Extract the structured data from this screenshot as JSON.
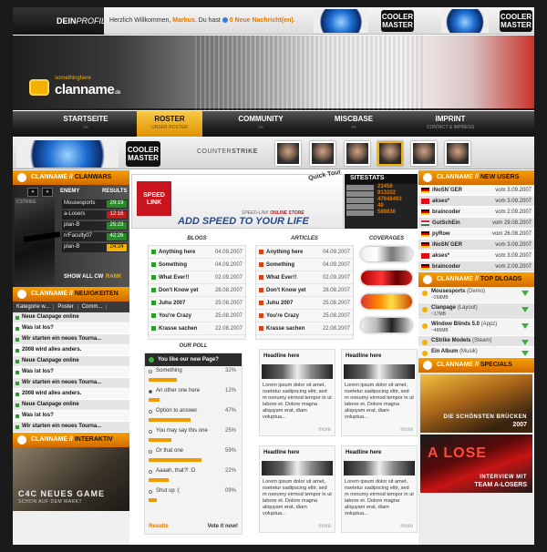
{
  "topbar": {
    "profile_prefix": "DEIN",
    "profile_suffix": "PROFIL",
    "welcome_text": "Herzlich Willkommen,",
    "user": "Markus",
    "you_have": ". Du hast",
    "messages": "0 Neue Nachricht(en)."
  },
  "brand": {
    "tagline": "somethinghere",
    "name": "clanname",
    "tld": ".de",
    "sponsor_a": "COOLER",
    "sponsor_b": "MASTER"
  },
  "nav": [
    {
      "label": "STARTSEITE",
      "sub": "»»"
    },
    {
      "label": "ROSTER",
      "sub": "UNSER ROSTER"
    },
    {
      "label": "COMMUNITY",
      "sub": "»»"
    },
    {
      "label": "MISCBASE",
      "sub": "»»"
    },
    {
      "label": "IMPRINT",
      "sub": "CONTACT & IMPRESS"
    }
  ],
  "strip": {
    "game_a": "COUNTER",
    "game_b": "STRIKE"
  },
  "clanwars": {
    "head_a": "CLANNAME",
    "head_b": "CLANWARS",
    "col_enemy": "ENEMY",
    "col_results": "RESULTS",
    "game": "CSTRIKE",
    "rows": [
      {
        "enemy": "Mousesports",
        "result": "29:19",
        "status": "win"
      },
      {
        "enemy": "a-Losers",
        "result": "12:16",
        "status": "loss"
      },
      {
        "enemy": "plan-B",
        "result": "25:23",
        "status": "win"
      },
      {
        "enemy": "n!Faculty07",
        "result": "42:26",
        "status": "win"
      },
      {
        "enemy": "plan-B",
        "result": "24:24",
        "status": "draw"
      }
    ],
    "tabs": "SHOW  ALL  CW",
    "rank": "RANK"
  },
  "news": {
    "head_a": "CLANNAME",
    "head_b": "NEUIGKEITEN",
    "filters": [
      "Kategorie w...",
      "Poster",
      "Comm..."
    ],
    "items": [
      "Neue Clanpage online",
      "Was ist los?",
      "Wir starten ein neues Tourna...",
      "2008 wird alles anders.",
      "Neue Clanpage online",
      "Was ist los?",
      "Wir starten ein neues Tourna...",
      "2008 wird alles anders.",
      "Neue Clanpage online",
      "Was ist los?",
      "Wir starten ein neues Tourna..."
    ]
  },
  "interaktiv": {
    "head_a": "CLANNAME",
    "head_b": "INTERAKTIV",
    "title": "C4C NEUES GAME",
    "sub": "SCHON AUF DEM MARKT"
  },
  "speedlink": {
    "logo": "SPEED LINK",
    "quick": "Quick Tour",
    "store_a": "SPEED-LINK",
    "store_b": "ONLINE STORE",
    "slogan": "ADD SPEED TO YOUR LIFE"
  },
  "sitestats": {
    "title": "SITESTATS",
    "values": [
      "23458",
      "913202",
      "47948463",
      "49",
      "589836"
    ]
  },
  "blogs": {
    "title": "BLOGS",
    "items": [
      {
        "name": "Anything here",
        "date": "04.09.2007"
      },
      {
        "name": "Something",
        "date": "04.09.2007"
      },
      {
        "name": "What Ever!!",
        "date": "02.09.2007"
      },
      {
        "name": "Don't Know yet",
        "date": "28.08.2007"
      },
      {
        "name": "Juhu 2007",
        "date": "25.08.2007"
      },
      {
        "name": "You're Crazy",
        "date": "25.08.2007"
      },
      {
        "name": "Krasse sachen",
        "date": "22.08.2007"
      }
    ]
  },
  "articles": {
    "title": "ARTICLES",
    "items": [
      {
        "name": "Anything here",
        "date": "04.09.2007"
      },
      {
        "name": "Something",
        "date": "04.09.2007"
      },
      {
        "name": "What Ever!!",
        "date": "02.09.2007"
      },
      {
        "name": "Don't Know yet",
        "date": "28.08.2007"
      },
      {
        "name": "Juhu 2007",
        "date": "25.08.2007"
      },
      {
        "name": "You're Crazy",
        "date": "25.08.2007"
      },
      {
        "name": "Krasse sachen",
        "date": "22.08.2007"
      }
    ]
  },
  "coverages": {
    "title": "COVERAGES"
  },
  "poll": {
    "title": "OUR POLL",
    "question": "You like our new Page?",
    "options": [
      {
        "text": "Something",
        "pct": "32%",
        "value": 32,
        "selected": false
      },
      {
        "text": "An other one here",
        "pct": "12%",
        "value": 12,
        "selected": true
      },
      {
        "text": "Option to answer",
        "pct": "47%",
        "value": 47,
        "selected": false
      },
      {
        "text": "You may say this one",
        "pct": "25%",
        "value": 25,
        "selected": false
      },
      {
        "text": "Or that one",
        "pct": "59%",
        "value": 59,
        "selected": false
      },
      {
        "text": "Aaaah, that?! :D",
        "pct": "22%",
        "value": 22,
        "selected": false
      },
      {
        "text": "Shut up :(",
        "pct": "09%",
        "value": 9,
        "selected": false
      }
    ],
    "results": "Results",
    "vote": "Vote it now!"
  },
  "featured": {
    "headline": "Headline here",
    "body": "Lorem ipsum dolor sit amet, nsetetur sadipscing elitr, sed m nonumy eirmod tempor in ut labore et. Dolore magna aliquyam erat, diam voluptua...",
    "more": "more"
  },
  "newusers": {
    "head_a": "CLANNAME",
    "head_b": "NEW USERS",
    "prefix": "vom",
    "items": [
      {
        "name": "iNoSN`GER",
        "date": "3.09.2007",
        "flag": "de"
      },
      {
        "name": "akses*",
        "date": "3.09.2007",
        "flag": "tr"
      },
      {
        "name": "braincoder",
        "date": "2.09.2007",
        "flag": "de"
      },
      {
        "name": "GutSchEin",
        "date": "29.08.2007",
        "flag": "hu"
      },
      {
        "name": "pyRow",
        "date": "26.08.2007",
        "flag": "de"
      },
      {
        "name": "iNoSN`GER",
        "date": "3.09.2007",
        "flag": "de"
      },
      {
        "name": "akses*",
        "date": "3.09.2007",
        "flag": "tr"
      },
      {
        "name": "braincoder",
        "date": "2.09.2007",
        "flag": "de"
      }
    ]
  },
  "downloads": {
    "head_a": "CLANNAME",
    "head_b": "TOP DLOADS",
    "items": [
      {
        "name": "Mousesports",
        "cat": "(Demo)",
        "size": "~268MB"
      },
      {
        "name": "Clanpage",
        "cat": "(Layout)",
        "size": "~17MB"
      },
      {
        "name": "Window Blinds 5.0",
        "cat": "(Appz)",
        "size": "~486MB"
      },
      {
        "name": "CStrike Models",
        "cat": "(Steam)",
        "size": ""
      },
      {
        "name": "Ein Album",
        "cat": "(Musik)",
        "size": ""
      }
    ]
  },
  "specials": {
    "head_a": "CLANNAME",
    "head_b": "SPECIALS",
    "items": [
      {
        "cap1": "DIE SCHÖNSTEN BRÜCKEN",
        "cap2": "2007"
      },
      {
        "cap1": "INTERVIEW MIT",
        "cap2": "TEAM A-LOSERS"
      }
    ]
  },
  "colors": {
    "orange": "#f19a00",
    "dark": "#222222",
    "green": "#2a9a2a",
    "red": "#c8141e"
  }
}
